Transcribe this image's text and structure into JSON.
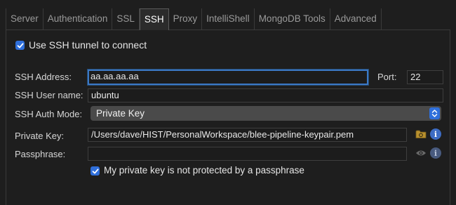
{
  "tabs": [
    {
      "label": "Server",
      "active": false
    },
    {
      "label": "Authentication",
      "active": false
    },
    {
      "label": "SSL",
      "active": false
    },
    {
      "label": "SSH",
      "active": true
    },
    {
      "label": "Proxy",
      "active": false
    },
    {
      "label": "IntelliShell",
      "active": false
    },
    {
      "label": "MongoDB Tools",
      "active": false
    },
    {
      "label": "Advanced",
      "active": false
    }
  ],
  "ssh": {
    "use_tunnel": {
      "label": "Use SSH tunnel to connect",
      "checked": true
    },
    "address": {
      "label": "SSH Address:",
      "value": "aa.aa.aa.aa"
    },
    "port": {
      "label": "Port:",
      "value": "22"
    },
    "user": {
      "label": "SSH User name:",
      "value": "ubuntu"
    },
    "auth_mode": {
      "label": "SSH Auth Mode:",
      "value": "Private Key"
    },
    "private_key": {
      "label": "Private Key:",
      "value": "/Users/dave/HIST/PersonalWorkspace/blee-pipeline-keypair.pem"
    },
    "passphrase": {
      "label": "Passphrase:",
      "value": ""
    },
    "no_passphrase": {
      "label": "My private key is not protected by a passphrase",
      "checked": true
    }
  },
  "icons": {
    "folder": "folder-icon",
    "info": "info-icon",
    "eye": "eye-icon",
    "check": "checkmark-icon",
    "updown": "chevron-updown-icon"
  },
  "colors": {
    "accent": "#2f6fdb",
    "focus_ring": "#3b78c5",
    "background": "#1e1e1e",
    "folder": "#b8902e"
  }
}
